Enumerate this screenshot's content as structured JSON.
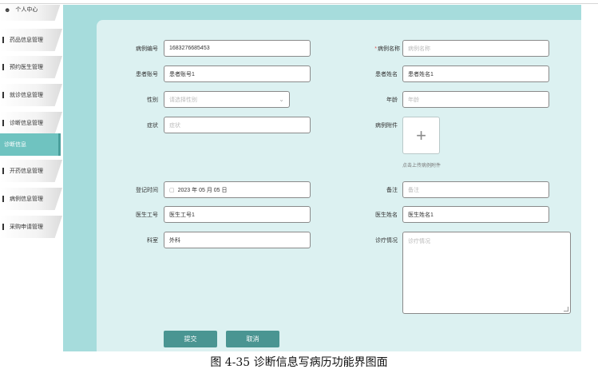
{
  "sidebar": {
    "items": [
      {
        "label": "个人中心",
        "icon": "person-icon"
      },
      {
        "label": "药品信息管理"
      },
      {
        "label": "预约医生管理"
      },
      {
        "label": "就诊信息管理"
      },
      {
        "label": "诊断信息管理"
      },
      {
        "label": "诊断信息",
        "active": true
      },
      {
        "label": "开药信息管理"
      },
      {
        "label": "病例信息管理"
      },
      {
        "label": "采购申请管理"
      }
    ]
  },
  "form": {
    "case_no": {
      "label": "病例编号",
      "value": "1683276685453"
    },
    "case_name": {
      "label": "病例名称",
      "placeholder": "病例名称",
      "required": true
    },
    "patient_account": {
      "label": "患者账号",
      "value": "患者账号1"
    },
    "patient_name": {
      "label": "患者姓名",
      "value": "患者姓名1"
    },
    "gender": {
      "label": "性别",
      "placeholder": "请选择性别"
    },
    "age": {
      "label": "年龄",
      "placeholder": "年龄"
    },
    "symptom": {
      "label": "症状",
      "placeholder": "症状"
    },
    "attachment": {
      "label": "病例附件",
      "hint": "点击上传病例附件",
      "plus": "+"
    },
    "reg_time": {
      "label": "登记时间",
      "value": "2023 年 05 月 05 日"
    },
    "remark": {
      "label": "备注",
      "placeholder": "备注"
    },
    "doctor_no": {
      "label": "医生工号",
      "value": "医生工号1"
    },
    "doctor_name": {
      "label": "医生姓名",
      "value": "医生姓名1"
    },
    "department": {
      "label": "科室",
      "value": "外科"
    },
    "diagnosis": {
      "label": "诊疗情况",
      "placeholder": "诊疗情况"
    }
  },
  "buttons": {
    "submit": "提交",
    "cancel": "取消"
  },
  "caption": "图 4-35 诊断信息写病历功能界图面",
  "colors": {
    "accent": "#4a9592",
    "sidebar_active": "#6fc3c0",
    "card_bg": "#dcf1f1",
    "strip_bg": "#a6dcdc"
  }
}
